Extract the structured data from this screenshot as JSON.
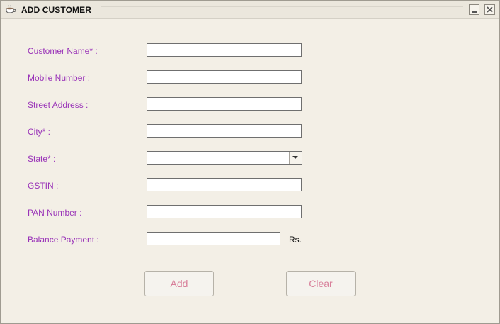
{
  "window": {
    "title": "ADD CUSTOMER",
    "icon": "coffee-cup-icon",
    "minimize_icon": "minimize-icon",
    "close_icon": "close-icon"
  },
  "form": {
    "customer_name": {
      "label": "Customer Name* :",
      "value": ""
    },
    "mobile_number": {
      "label": "Mobile Number :",
      "value": ""
    },
    "street_address": {
      "label": "Street Address :",
      "value": ""
    },
    "city": {
      "label": "City* :",
      "value": ""
    },
    "state": {
      "label": "State* :",
      "selected": "",
      "arrow_icon": "chevron-down-icon"
    },
    "gstin": {
      "label": "GSTIN :",
      "value": ""
    },
    "pan_number": {
      "label": "PAN Number :",
      "value": ""
    },
    "balance_payment": {
      "label": "Balance Payment :",
      "value": "",
      "unit": "Rs."
    }
  },
  "buttons": {
    "add": "Add",
    "clear": "Clear"
  },
  "colors": {
    "label": "#9932b8",
    "button_text": "#d87f9a",
    "background": "#f3efe6"
  }
}
